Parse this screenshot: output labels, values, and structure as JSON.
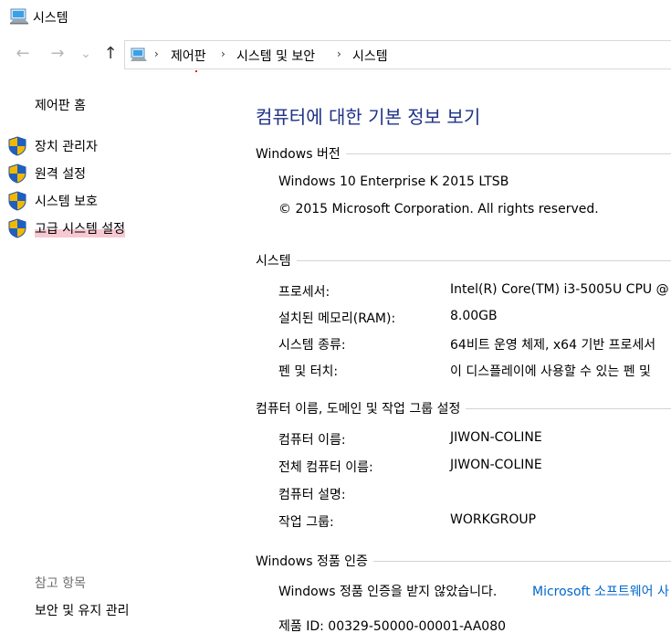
{
  "window": {
    "title": "시스템"
  },
  "nav": {
    "back_label": "←",
    "forward_label": "→",
    "recent_label": "⌄",
    "up_label": "↑"
  },
  "breadcrumb": [
    {
      "label": "제어판"
    },
    {
      "label": "시스템 및 보안"
    },
    {
      "label": "시스템"
    }
  ],
  "breadcrumb_separator": "›",
  "sidebar": {
    "home": "제어판 홈",
    "links": [
      {
        "label": "장치 관리자"
      },
      {
        "label": "원격 설정"
      },
      {
        "label": "시스템 보호"
      },
      {
        "label": "고급 시스템 설정"
      }
    ],
    "see_also_title": "참고 항목",
    "see_also_link": "보안 및 유지 관리"
  },
  "main": {
    "title": "컴퓨터에 대한 기본 정보 보기",
    "windows_edition": {
      "heading": "Windows 버전",
      "edition": "Windows 10 Enterprise K 2015 LTSB",
      "copyright": "© 2015 Microsoft Corporation. All rights reserved."
    },
    "system": {
      "heading": "시스템",
      "rows": [
        {
          "label": "프로세서:",
          "value": "Intel(R) Core(TM) i3-5005U CPU @"
        },
        {
          "label": "설치된 메모리(RAM):",
          "value": "8.00GB"
        },
        {
          "label": "시스템 종류:",
          "value": "64비트 운영 체제, x64 기반 프로세서"
        },
        {
          "label": "펜 및 터치:",
          "value": "이 디스플레이에 사용할 수 있는 펜 및"
        }
      ]
    },
    "computer_name": {
      "heading": "컴퓨터 이름, 도메인 및 작업 그룹 설정",
      "rows": [
        {
          "label": "컴퓨터 이름:",
          "value": "JIWON-COLINE"
        },
        {
          "label": "전체 컴퓨터 이름:",
          "value": "JIWON-COLINE"
        },
        {
          "label": "컴퓨터 설명:",
          "value": ""
        },
        {
          "label": "작업 그룹:",
          "value": "WORKGROUP"
        }
      ]
    },
    "activation": {
      "heading": "Windows 정품 인증",
      "status": "Windows 정품 인증을 받지 않았습니다.",
      "link": "Microsoft 소프트웨어 사",
      "product_id": "제품 ID: 00329-50000-00001-AA080"
    }
  },
  "colors": {
    "title_blue": "#1e3287",
    "link_blue": "#0066cc",
    "muted_gray": "#6d6d6d",
    "highlight_pink": "#f7c9d3"
  }
}
